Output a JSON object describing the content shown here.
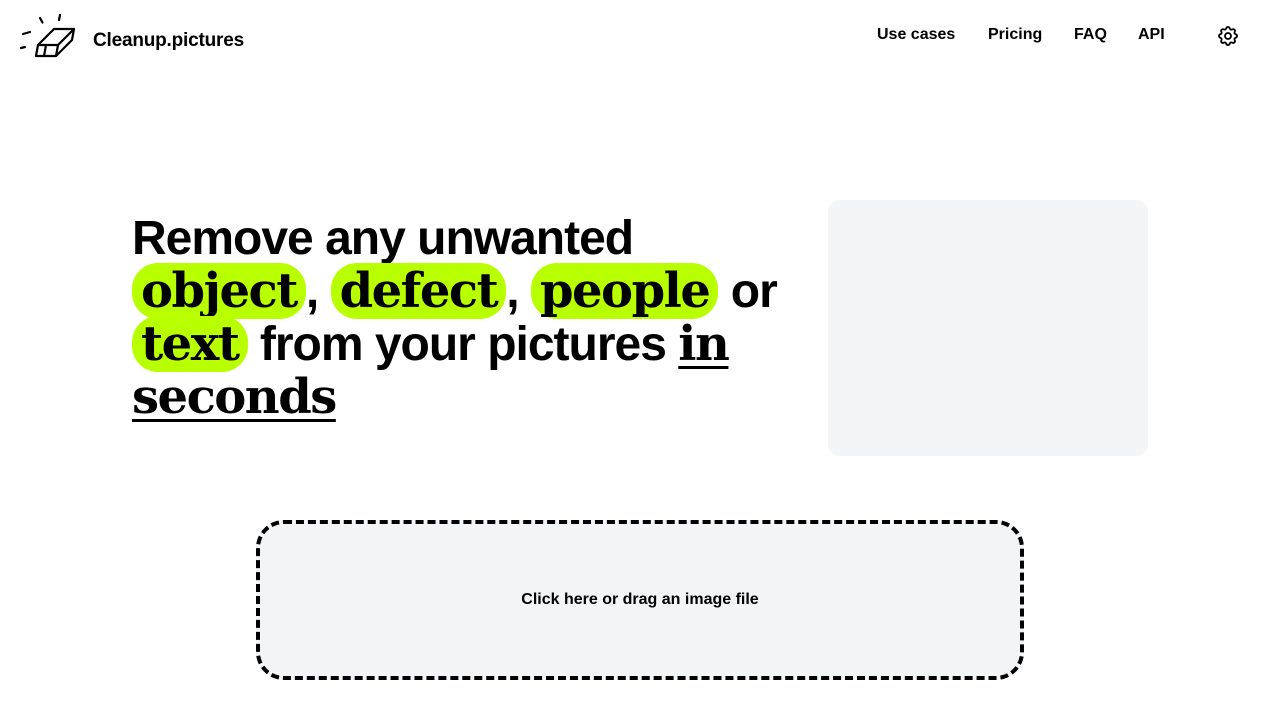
{
  "header": {
    "brand": "Cleanup.pictures",
    "logo_icon": "eraser-icon",
    "nav": [
      {
        "label": "Use cases"
      },
      {
        "label": "Pricing"
      },
      {
        "label": "FAQ"
      },
      {
        "label": "API"
      }
    ],
    "settings_icon": "gear-icon"
  },
  "hero": {
    "line1": "Remove any unwanted",
    "word_object": "object",
    "comma1": ",",
    "word_defect": "defect",
    "comma2": ",",
    "word_people": "people",
    "word_or": "or",
    "word_text": "text",
    "mid_text": "from your pictures",
    "word_in": "in",
    "word_seconds": "seconds",
    "highlight_color": "#b8ff00"
  },
  "upload": {
    "label": "Click here or drag an image file"
  },
  "colors": {
    "background": "#ffffff",
    "panel": "#f3f4f6",
    "text": "#000000"
  }
}
